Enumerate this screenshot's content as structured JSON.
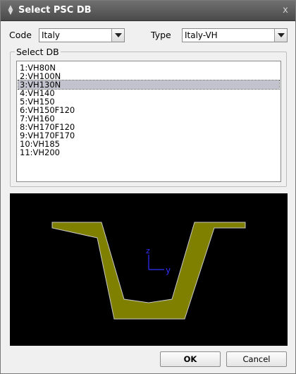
{
  "window": {
    "title": "Select PSC DB",
    "close_glyph": "x"
  },
  "filters": {
    "code_label": "Code",
    "code_value": "Italy",
    "type_label": "Type",
    "type_value": "Italy-VH"
  },
  "select_db": {
    "group_label": "Select DB",
    "items": [
      "1:VH80N",
      "2:VH100N",
      "3:VH130N",
      "4:VH140",
      "5:VH150",
      "6:VH150F120",
      "7:VH160",
      "8:VH170F120",
      "9:VH170F170",
      "10:VH185",
      "11:VH200"
    ],
    "selected_index": 2
  },
  "preview": {
    "section_fill": "#808000",
    "section_stroke": "#c8c8c8",
    "axis_color": "#3030ff",
    "axis_z_label": "z",
    "axis_y_label": "y"
  },
  "buttons": {
    "ok_label": "OK",
    "cancel_label": "Cancel"
  }
}
